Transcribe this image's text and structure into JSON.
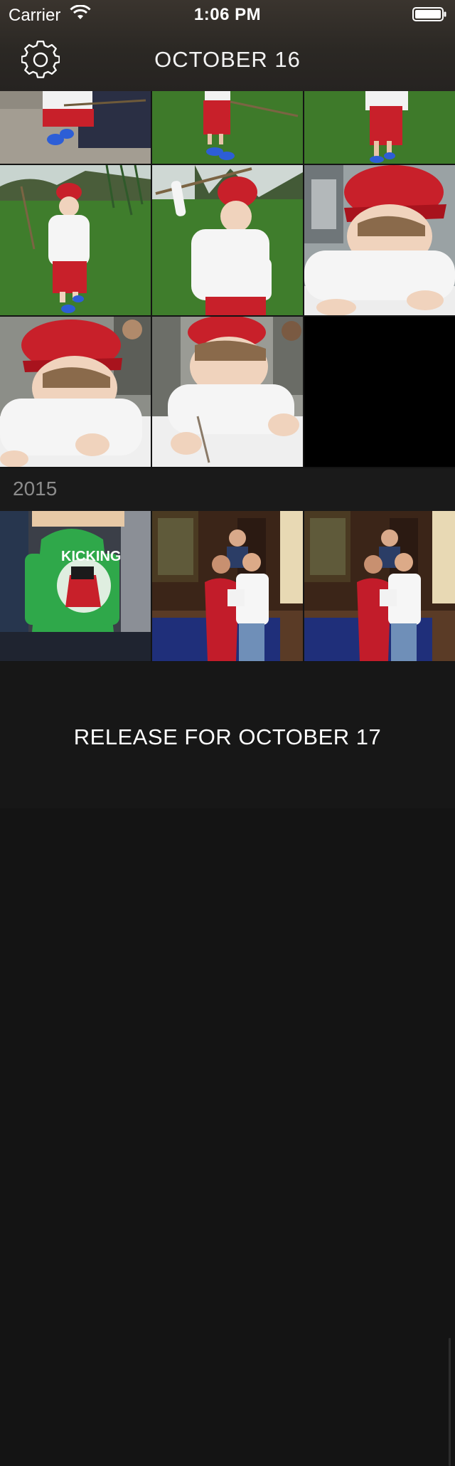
{
  "status_bar": {
    "carrier": "Carrier",
    "time": "1:06 PM"
  },
  "header": {
    "title": "OCTOBER 16",
    "settings_icon": "gear-icon"
  },
  "section": {
    "year": "2015"
  },
  "footer": {
    "release_label": "RELEASE FOR OCTOBER 17"
  },
  "colors": {
    "header_bg": "#2b2824",
    "page_bg": "#141414",
    "year_text": "#8c8c8c",
    "hat_red": "#c8202a",
    "grass": "#3e7a2a",
    "hoodie_green": "#2fa84a"
  }
}
